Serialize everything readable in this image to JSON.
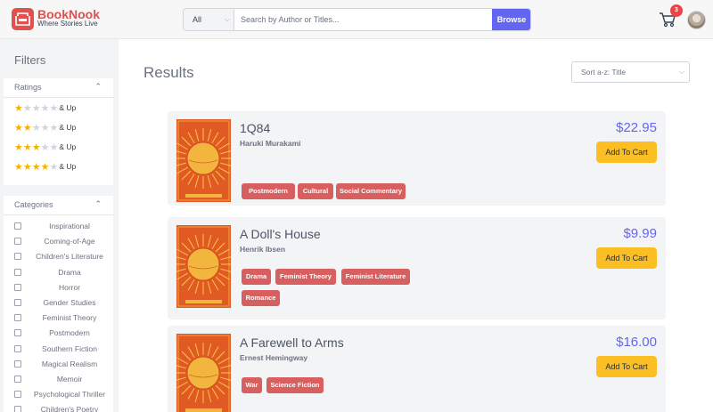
{
  "header": {
    "brand": "BookNook",
    "tagline": "Where Stories Live",
    "search": {
      "filter_value": "All",
      "placeholder": "Search by Author or Titles...",
      "button_label": "Browse"
    },
    "cart_count": "3"
  },
  "sidebar": {
    "title": "Filters",
    "ratings": {
      "label": "Ratings",
      "items": [
        {
          "stars": 1,
          "suffix": "& Up"
        },
        {
          "stars": 2,
          "suffix": "& Up"
        },
        {
          "stars": 3,
          "suffix": "& Up"
        },
        {
          "stars": 4,
          "suffix": "& Up"
        }
      ]
    },
    "categories": {
      "label": "Categories",
      "items": [
        "Inspirational",
        "Coming-of-Age",
        "Children's Literature",
        "Drama",
        "Horror",
        "Gender Studies",
        "Feminist Theory",
        "Postmodern",
        "Southern Fiction",
        "Magical Realism",
        "Memoir",
        "Psychological Thriller",
        "Children's Poetry"
      ]
    }
  },
  "main": {
    "title": "Results",
    "sort_value": "Sort a-z: Title",
    "add_to_cart_label": "Add To Cart",
    "books": [
      {
        "title": "1Q84",
        "author": "Haruki Murakami",
        "price": "$22.95",
        "tags": [
          "Postmodern",
          "Cultural",
          "Social Commentary"
        ]
      },
      {
        "title": "A Doll's House",
        "author": "Henrik Ibsen",
        "price": "$9.99",
        "tags": [
          "Drama",
          "Feminist Theory",
          "Feminist Literature",
          "Romance"
        ]
      },
      {
        "title": "A Farewell to Arms",
        "author": "Ernest Hemingway",
        "price": "$16.00",
        "tags": [
          "War",
          "Science Fiction"
        ]
      }
    ]
  },
  "colors": {
    "brand": "#d9534f",
    "accent": "#6366f1",
    "cart_button": "#fbbf24",
    "tag": "#d75f5f",
    "star": "#f5b301"
  }
}
